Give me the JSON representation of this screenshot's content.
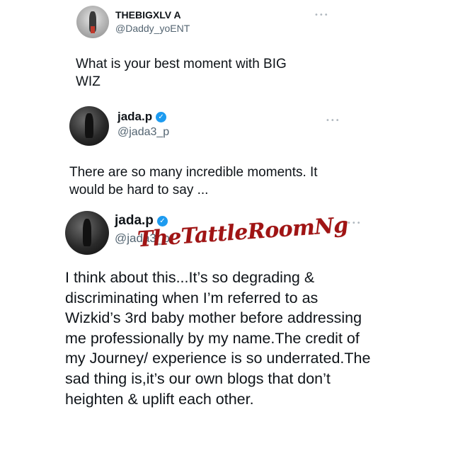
{
  "tweets": [
    {
      "name": "THEBIGXLV A",
      "handle": "@Daddy_yoENT",
      "verified": false,
      "more": "•••",
      "text": "What is your best moment with BIG WIZ"
    },
    {
      "name": "jada.p",
      "handle": "@jada3_p",
      "verified": true,
      "more": "•••",
      "text": "There are so many incredible moments. It would be hard to say ..."
    },
    {
      "name": "jada.p",
      "handle": "@jada3_p",
      "verified": true,
      "more": "•••",
      "text": "I think about this...It’s so degrading & discriminating when I’m referred to as Wizkid’s 3rd baby mother before addressing me professionally by my name.The credit of my Journey/ experience is so underrated.The sad thing is,it’s our own blogs that don’t heighten & uplift each other."
    }
  ],
  "watermark": "TheTattleRoomNg",
  "verified_glyph": "✓",
  "colors": {
    "verified": "#1d9bf0",
    "handle": "#536471",
    "watermark": "#a01414"
  }
}
